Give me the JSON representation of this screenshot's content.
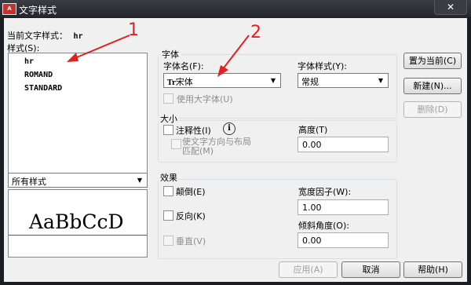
{
  "window": {
    "title": "文字样式",
    "app_icon_text": "A"
  },
  "current_style": {
    "label": "当前文字样式：",
    "value": "hr"
  },
  "styles": {
    "label": "样式(S):",
    "items": [
      "hr",
      "ROMAND",
      "STANDARD"
    ],
    "filter_value": "所有样式"
  },
  "preview": {
    "text": "AaBbCcD",
    "baseline_color": "#e1201f"
  },
  "font": {
    "group_label": "字体",
    "name_label": "字体名(F):",
    "name_value": "宋体",
    "name_icon_text": "Tr",
    "style_label": "字体样式(Y):",
    "style_value": "常规",
    "bigfont_label": "使用大字体(U)"
  },
  "size": {
    "group_label": "大小",
    "annotative_label": "注释性(I)",
    "info_icon_text": "i",
    "match_orientation_line1": "使文字方向与布局",
    "match_orientation_line2": "匹配(M)",
    "height_label": "高度(T)",
    "height_value": "0.00"
  },
  "effects": {
    "group_label": "效果",
    "upside_down_label": "颠倒(E)",
    "backwards_label": "反向(K)",
    "vertical_label": "垂直(V)",
    "width_factor_label": "宽度因子(W):",
    "width_factor_value": "1.00",
    "oblique_label": "倾斜角度(O):",
    "oblique_value": "0.00"
  },
  "buttons": {
    "set_current": "置为当前(C)",
    "new": "新建(N)...",
    "delete": "删除(D)",
    "apply": "应用(A)",
    "cancel": "取消",
    "help": "帮助(H)"
  },
  "annotations": {
    "marker1": "1",
    "marker2": "2",
    "color": "#e1201f"
  }
}
